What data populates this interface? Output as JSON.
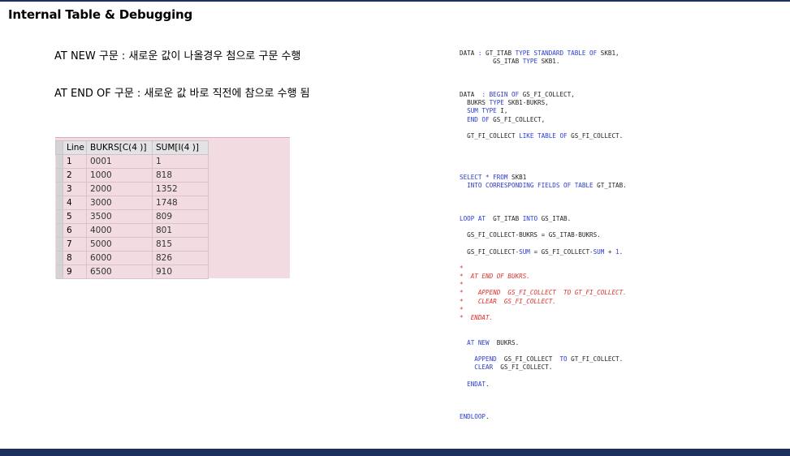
{
  "title": "Internal Table & Debugging",
  "notes": {
    "at_new": "AT NEW 구문 : 새로운 값이 나올경우 첨으로 구문 수행",
    "at_end": "AT END OF 구문 : 새로운 값 바로 직전에 참으로 수행 됨"
  },
  "grid": {
    "headers": [
      "Line",
      "BUKRS[C(4 )]",
      "SUM[I(4 )]"
    ],
    "rows": [
      [
        "1",
        "0001",
        "1"
      ],
      [
        "2",
        "1000",
        "818"
      ],
      [
        "3",
        "2000",
        "1352"
      ],
      [
        "4",
        "3000",
        "1748"
      ],
      [
        "5",
        "3500",
        "809"
      ],
      [
        "6",
        "4000",
        "801"
      ],
      [
        "7",
        "5000",
        "815"
      ],
      [
        "8",
        "6000",
        "826"
      ],
      [
        "9",
        "6500",
        "910"
      ]
    ]
  },
  "code": [
    [
      [
        "t",
        "DATA "
      ],
      [
        "k",
        ": "
      ],
      [
        "t",
        "GT_ITAB "
      ],
      [
        "k",
        "TYPE STANDARD TABLE OF "
      ],
      [
        "t",
        "SKB1,"
      ]
    ],
    [
      [
        "t",
        "         GS_ITAB "
      ],
      [
        "k",
        "TYPE "
      ],
      [
        "t",
        "SKB1."
      ]
    ],
    [],
    [],
    [],
    [
      [
        "t",
        "DATA  "
      ],
      [
        "k",
        ": BEGIN OF "
      ],
      [
        "t",
        "GS_FI_COLLECT,"
      ]
    ],
    [
      [
        "t",
        "  BUKRS "
      ],
      [
        "k",
        "TYPE "
      ],
      [
        "t",
        "SKB1-BUKRS,"
      ]
    ],
    [
      [
        "k",
        "  SUM TYPE "
      ],
      [
        "t",
        "I,"
      ]
    ],
    [
      [
        "k",
        "  END OF "
      ],
      [
        "t",
        "GS_FI_COLLECT,"
      ]
    ],
    [],
    [
      [
        "t",
        "  GT_FI_COLLECT "
      ],
      [
        "k",
        "LIKE TABLE OF "
      ],
      [
        "t",
        "GS_FI_COLLECT."
      ]
    ],
    [],
    [],
    [],
    [],
    [
      [
        "k",
        "SELECT * FROM "
      ],
      [
        "t",
        "SKB1"
      ]
    ],
    [
      [
        "k",
        "  INTO CORRESPONDING FIELDS OF TABLE "
      ],
      [
        "t",
        "GT_ITAB."
      ]
    ],
    [],
    [],
    [],
    [
      [
        "k",
        "LOOP AT  "
      ],
      [
        "t",
        "GT_ITAB "
      ],
      [
        "k",
        "INTO "
      ],
      [
        "t",
        "GS_ITAB."
      ]
    ],
    [],
    [
      [
        "t",
        "  GS_FI_COLLECT-BUKRS = GS_ITAB-BUKRS."
      ]
    ],
    [],
    [
      [
        "t",
        "  GS_FI_COLLECT-"
      ],
      [
        "k",
        "SUM "
      ],
      [
        "t",
        "= GS_FI_COLLECT-"
      ],
      [
        "k",
        "SUM "
      ],
      [
        "t",
        "+ "
      ],
      [
        "k",
        "1"
      ],
      [
        "t",
        "."
      ]
    ],
    [],
    [
      [
        "c",
        "*"
      ]
    ],
    [
      [
        "c",
        "*  AT END OF BUKRS."
      ]
    ],
    [
      [
        "c",
        "*"
      ]
    ],
    [
      [
        "c",
        "*    APPEND  GS_FI_COLLECT  TO GT_FI_COLLECT."
      ]
    ],
    [
      [
        "c",
        "*    CLEAR  GS_FI_COLLECT."
      ]
    ],
    [
      [
        "c",
        "*"
      ]
    ],
    [
      [
        "c",
        "*  ENDAT."
      ]
    ],
    [],
    [],
    [
      [
        "k",
        "  AT NEW  "
      ],
      [
        "t",
        "BUKRS."
      ]
    ],
    [],
    [
      [
        "k",
        "    APPEND  "
      ],
      [
        "t",
        "GS_FI_COLLECT  "
      ],
      [
        "k",
        "TO "
      ],
      [
        "t",
        "GT_FI_COLLECT."
      ]
    ],
    [
      [
        "k",
        "    CLEAR  "
      ],
      [
        "t",
        "GS_FI_COLLECT."
      ]
    ],
    [],
    [
      [
        "k",
        "  ENDAT"
      ],
      [
        "t",
        "."
      ]
    ],
    [],
    [],
    [],
    [
      [
        "k",
        "ENDLOOP"
      ],
      [
        "t",
        "."
      ]
    ]
  ],
  "colors": {
    "keyword": "#2a3bd0",
    "comment": "#e0302a",
    "panel": "#f2dce1",
    "bar": "#1c2f5e"
  }
}
